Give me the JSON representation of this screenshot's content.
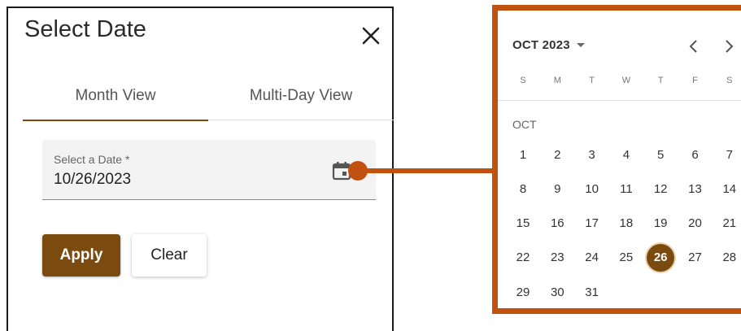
{
  "dialog": {
    "title": "Select Date",
    "tabs": [
      {
        "label": "Month View",
        "active": true
      },
      {
        "label": "Multi-Day View",
        "active": false
      }
    ],
    "date_field": {
      "label": "Select a Date *",
      "value": "10/26/2023",
      "icon": "calendar-icon"
    },
    "buttons": {
      "apply_label": "Apply",
      "clear_label": "Clear"
    }
  },
  "calendar": {
    "header": "OCT 2023",
    "weekdays": [
      "S",
      "M",
      "T",
      "W",
      "T",
      "F",
      "S"
    ],
    "month_label": "OCT",
    "first_weekday_index": 0,
    "days_in_month": 31,
    "selected_day": 26
  },
  "colors": {
    "brand": "#7b4a0f",
    "connector": "#c0510e"
  }
}
